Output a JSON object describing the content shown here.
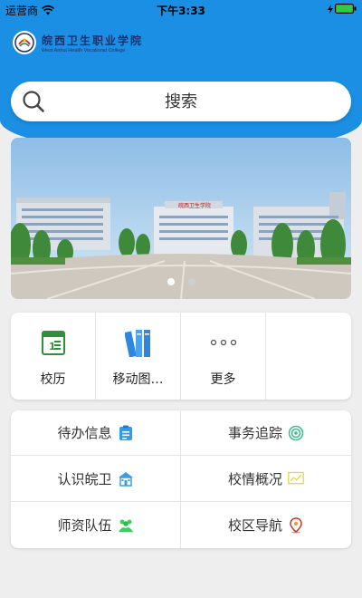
{
  "status_bar": {
    "carrier": "运营商",
    "time": "下午3:33"
  },
  "header": {
    "logo_cn": "皖西卫生职业学院",
    "logo_en": "West Anhui Health Vocational College",
    "brand_color": "#1a8fe3"
  },
  "search": {
    "placeholder": "搜索",
    "icon": "search-icon"
  },
  "banner": {
    "building_sign": "皖西卫生学院",
    "page_count": 2,
    "active_page": 1
  },
  "functions": [
    {
      "label": "校历",
      "icon": "calendar-icon"
    },
    {
      "label": "移动图…",
      "icon": "library-books-icon"
    },
    {
      "label": "更多",
      "icon": "more-icon"
    }
  ],
  "info_grid": [
    {
      "label": "待办信息",
      "icon": "clipboard-icon",
      "color": "#2d9ee8"
    },
    {
      "label": "事务追踪",
      "icon": "target-icon",
      "color": "#3dbd8b"
    },
    {
      "label": "认识皖卫",
      "icon": "school-icon",
      "color": "#3a9ee0"
    },
    {
      "label": "校情概况",
      "icon": "chart-icon",
      "color": "#e8d23a"
    },
    {
      "label": "师资队伍",
      "icon": "people-icon",
      "color": "#3ccf5e"
    },
    {
      "label": "校区导航",
      "icon": "location-icon",
      "color": "#c0392b"
    }
  ]
}
